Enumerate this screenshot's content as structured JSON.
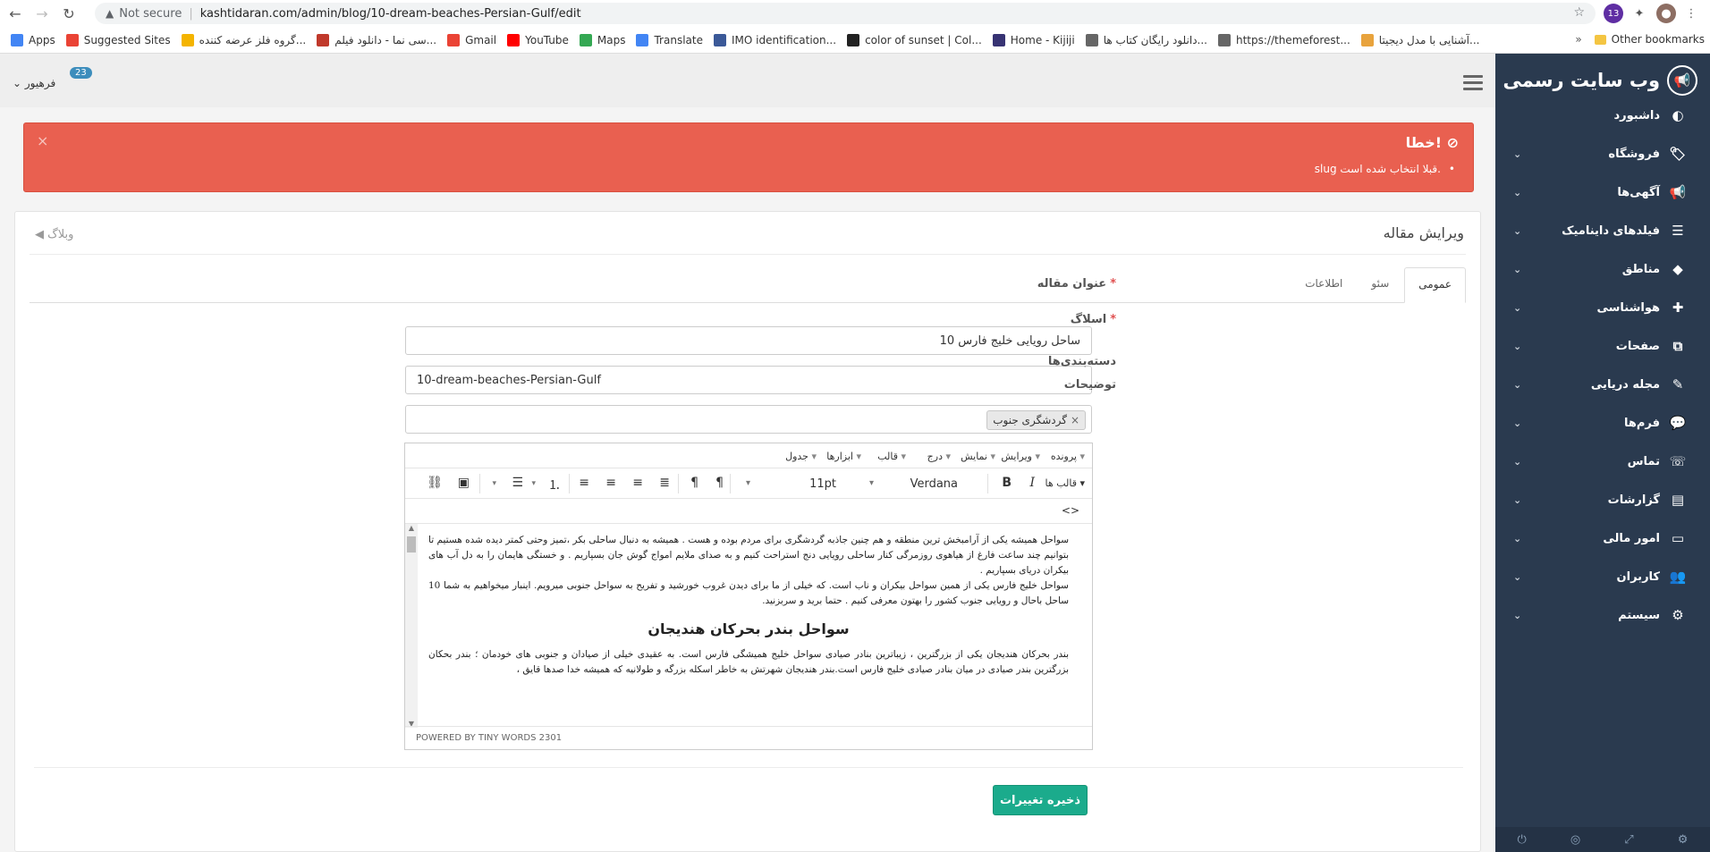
{
  "browser": {
    "security": "Not secure",
    "url": "kashtidaran.com/admin/blog/10-dream-beaches-Persian-Gulf/edit",
    "ext_badge": "13",
    "bookmarks": [
      {
        "label": "Apps",
        "color": "#4285f4"
      },
      {
        "label": "Suggested Sites",
        "color": "#ea4335"
      },
      {
        "label": "گروه فلز عرضه کننده...",
        "color": "#f4b400"
      },
      {
        "label": "سی نما - دانلود فیلم...",
        "color": "#c0392b"
      },
      {
        "label": "Gmail",
        "color": "#ea4335"
      },
      {
        "label": "YouTube",
        "color": "#ff0000"
      },
      {
        "label": "Maps",
        "color": "#34a853"
      },
      {
        "label": "Translate",
        "color": "#4285f4"
      },
      {
        "label": "IMO identification...",
        "color": "#3b5998"
      },
      {
        "label": "color of sunset | Col...",
        "color": "#222222"
      },
      {
        "label": "Home - Kijiji",
        "color": "#373373"
      },
      {
        "label": "دانلود رایگان کتاب ها...",
        "color": "#666666"
      },
      {
        "label": "https://themeforest...",
        "color": "#666666"
      },
      {
        "label": "آشنایی با مدل دیجیتا...",
        "color": "#e8a33d"
      }
    ],
    "more_bookmarks": "»",
    "other_bookmarks": "Other bookmarks"
  },
  "topbar": {
    "notif_count": "23",
    "user_name": "فرهیور"
  },
  "sidebar": {
    "brand": "وب سایت رسمی",
    "items": [
      {
        "label": "داشبورد",
        "icon": "◐",
        "chevron": ""
      },
      {
        "label": "فروشگاه",
        "icon": "🏷",
        "chevron": "⌄"
      },
      {
        "label": "آگهی‌ها",
        "icon": "📢",
        "chevron": "⌄"
      },
      {
        "label": "فیلدهای داینامیک",
        "icon": "☰",
        "chevron": "⌄"
      },
      {
        "label": "مناطق",
        "icon": "◆",
        "chevron": "⌄"
      },
      {
        "label": "هواشناسی",
        "icon": "✚",
        "chevron": "⌄"
      },
      {
        "label": "صفحات",
        "icon": "⧉",
        "chevron": "⌄"
      },
      {
        "label": "مجله دریایی",
        "icon": "✎",
        "chevron": "⌄"
      },
      {
        "label": "فرم‌ها",
        "icon": "💬",
        "chevron": "⌄"
      },
      {
        "label": "تماس",
        "icon": "☏",
        "chevron": "⌄"
      },
      {
        "label": "گزارشات",
        "icon": "▤",
        "chevron": "⌄"
      },
      {
        "label": "امور مالی",
        "icon": "▭",
        "chevron": "⌄"
      },
      {
        "label": "کاربران",
        "icon": "👥",
        "chevron": "⌄"
      },
      {
        "label": "سیستم",
        "icon": "⚙",
        "chevron": "⌄"
      }
    ]
  },
  "alert": {
    "title": "خطا!",
    "message": "slug قبلا انتخاب شده است.",
    "close": "×",
    "color": "#e96050"
  },
  "panel": {
    "title": "ویرایش مقاله",
    "back": "وبلاگ",
    "tabs": [
      "عمومی",
      "سئو",
      "اطلاعات"
    ]
  },
  "form": {
    "title_label": "عنوان مقاله",
    "title_value": "10 ساحل رویایی خلیج فارس",
    "slug_label": "اسلاگ",
    "slug_value": "10-dream-beaches-Persian-Gulf",
    "categories_label": "دسته‌بندی‌ها",
    "category_tag": "گردشگری جنوب",
    "description_label": "توضیحات",
    "required_mark": "*"
  },
  "editor": {
    "menus": [
      "پرونده",
      "ویرایش",
      "نمایش",
      "درج",
      "قالب",
      "ابزارها",
      "جدول"
    ],
    "formats": "قالب ها",
    "font": "Verdana",
    "size": "11pt",
    "p1": "سواحل همیشه یکی از آرامبخش ترین منطقه و هم چنین جاذبه گردشگری برای مردم بوده و هست . همیشه به دنبال ساحلی بکر ،تمیز وحتی  کمتر دیده شده هستیم تا بتوانیم چند ساعت فارغ از هیاهوی روزمرگی کنار ساحلی رویایی دنج استراحت کنیم و به صدای ملایم امواج گوش جان بسپاریم . و خستگی هایمان را به دل آب های بیکران دریای بسپاریم .",
    "p2": "سواحل خلیج فارس یکی از همین سواحل بیکران و ناب است. که خیلی از ما برای دیدن غروب  خورشید و تفریح به سواحل جنوبی میرویم. اینبار میخواهیم به شما 10 ساحل باحال و رویایی جنوب کشور را بهتون معرفی کنیم . حتما برید و سربزنید.",
    "heading": "سواحل بندر بحرکان هندیجان",
    "p3": "بندر بحرکان هندیجان یکی از بزرگترین ، زیباترین بنادر صیادی سواحل خلیج همیشگی فارس است. به عقیدی خیلی از صیادان و جنوبی های خودمان ؛ بندر بحکان بزرگترین بندر صیادی در میان بنادر صیادی خلیج فارس است.بندر هندیجان شهرتش به خاطر اسکله بزرگه و طولانیه که همیشه خدا صدها قایق ،",
    "status": "POWERED BY TINY  WORDS 2301",
    "source_code": "<>"
  },
  "save_button": "ذخیره تغییرات"
}
